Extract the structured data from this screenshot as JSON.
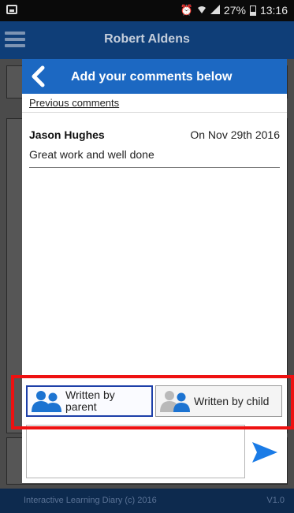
{
  "status_bar": {
    "alarm_icon": "alarm-icon",
    "wifi_icon": "wifi-icon",
    "signal_icon": "signal-icon",
    "battery_percent": "27%",
    "battery_icon": "battery-icon",
    "time": "13:16"
  },
  "app_bar": {
    "menu_icon": "hamburger-menu-icon",
    "title": "Robert Aldens"
  },
  "dialog": {
    "back_icon": "back-chevron-icon",
    "title": "Add your comments below",
    "previous_comments_label": "Previous comments",
    "comments": [
      {
        "author": "Jason Hughes",
        "date": "On Nov 29th 2016",
        "text": "Great work and well done"
      }
    ],
    "writer_options": [
      {
        "label": "Written by parent",
        "icon": "parent-group-icon",
        "selected": true
      },
      {
        "label": "Written by child",
        "icon": "child-group-icon",
        "selected": false
      }
    ],
    "comment_input": {
      "value": "",
      "placeholder": ""
    },
    "send_icon": "send-arrow-icon"
  },
  "footer": {
    "text": "Interactive Learning Diary (c) 2016",
    "version": "V1.0"
  },
  "colors": {
    "app_bar": "#0f3e78",
    "dialog_header": "#1c68c2",
    "selected_border": "#1d3fa8",
    "highlight": "#ee1111",
    "send": "#1a7be6"
  }
}
